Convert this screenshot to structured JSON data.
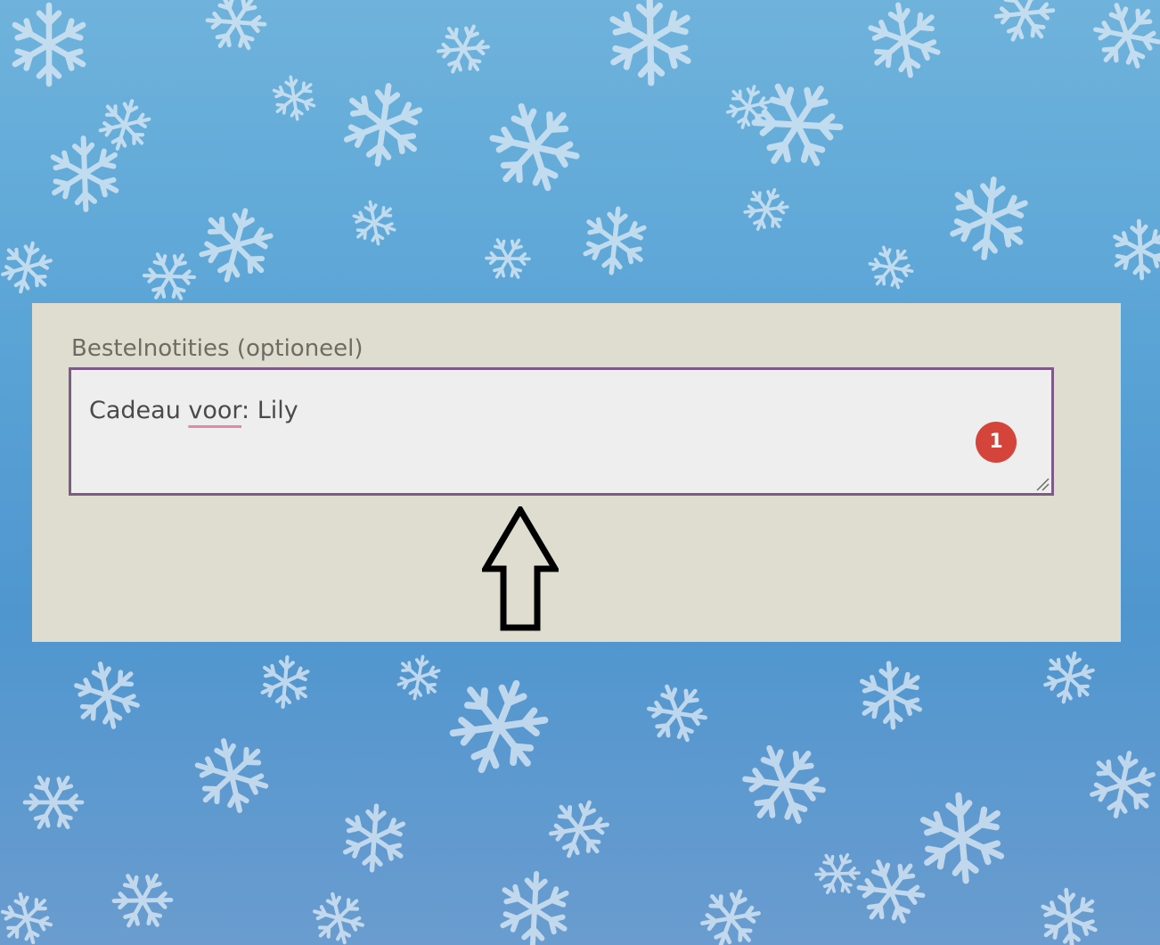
{
  "background": {
    "theme": "snowflakes",
    "colors": {
      "sky_top": "#6fb3dc",
      "sky_bottom": "#6a9ccf",
      "flake": "#dce9f5"
    }
  },
  "order_notes": {
    "label": "Bestelnotities (optioneel)",
    "value": {
      "before": "Cadeau ",
      "misspelled": "voor",
      "after": ": Lily"
    },
    "badge_count": "1",
    "colors": {
      "panel": "#dfddd0",
      "field_border": "#7e5a86",
      "badge": "#d5443a",
      "spell_underline": "#e08aa8"
    }
  },
  "annotation": {
    "icon": "up-arrow-icon"
  }
}
